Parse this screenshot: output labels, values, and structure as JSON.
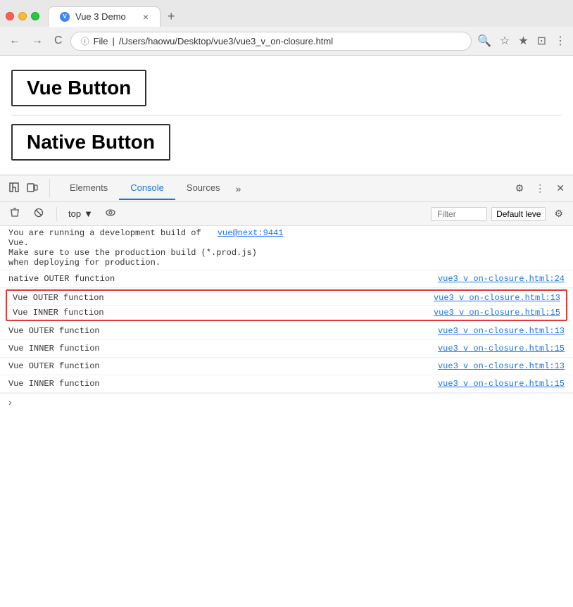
{
  "browser": {
    "tab_title": "Vue 3 Demo",
    "tab_close": "×",
    "tab_new": "+",
    "address_protocol": "File",
    "address_path": "/Users/haowu/Desktop/vue3/vue3_v_on-closure.html",
    "nav_back": "←",
    "nav_forward": "→",
    "nav_refresh": "C"
  },
  "page": {
    "vue_button_label": "Vue Button",
    "native_button_label": "Native Button"
  },
  "devtools": {
    "tabs": [
      {
        "label": "Elements"
      },
      {
        "label": "Console"
      },
      {
        "label": "Sources"
      }
    ],
    "tab_more": "»",
    "active_tab": "Console",
    "context": "top",
    "filter_placeholder": "Filter",
    "level_label": "Default leve",
    "console_messages": [
      {
        "text": "You are running a development build of vue@next:9441\nVue.\nMake sure to use the production build (*.prod.js)\nwhen deploying for production.",
        "link": null,
        "multiline": true,
        "warning": true
      },
      {
        "text": "native OUTER function",
        "link": "vue3 v on-closure.html:24",
        "highlighted": false
      },
      {
        "text": "Vue OUTER function",
        "link": "vue3 v on-closure.html:13",
        "highlighted": true
      },
      {
        "text": "Vue INNER function",
        "link": "vue3 v on-closure.html:15",
        "highlighted": true
      },
      {
        "text": "Vue OUTER function",
        "link": "vue3 v on-closure.html:13",
        "highlighted": false
      },
      {
        "text": "Vue INNER function",
        "link": "vue3 v on-closure.html:15",
        "highlighted": false
      },
      {
        "text": "Vue OUTER function",
        "link": "vue3 v on-closure.html:13",
        "highlighted": false
      },
      {
        "text": "Vue INNER function",
        "link": "vue3 v on-closure.html:15",
        "highlighted": false
      }
    ],
    "vue_link_text": "vue@next:9441"
  }
}
